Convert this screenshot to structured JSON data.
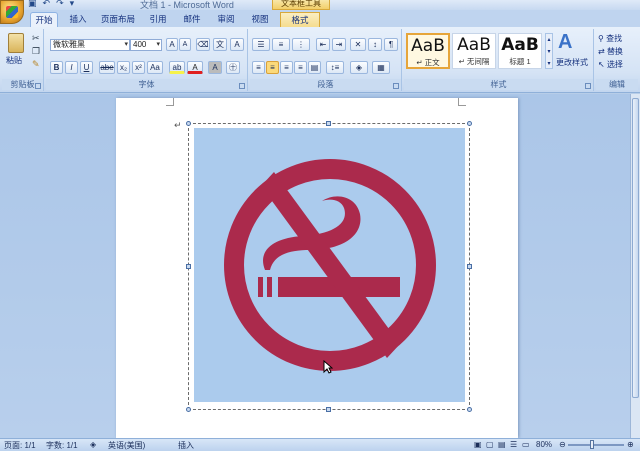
{
  "window": {
    "title": "文档 1 - Microsoft Word",
    "context_tab_header": "文本框工具",
    "qat_icons": [
      "save-icon",
      "undo-icon",
      "redo-icon"
    ]
  },
  "tabs": [
    {
      "label": "开始",
      "active": true
    },
    {
      "label": "插入"
    },
    {
      "label": "页面布局"
    },
    {
      "label": "引用"
    },
    {
      "label": "邮件"
    },
    {
      "label": "审阅"
    },
    {
      "label": "视图"
    },
    {
      "label": "格式",
      "contextual": true
    }
  ],
  "ribbon": {
    "clipboard": {
      "paste_label": "粘贴",
      "group_label": "剪贴板"
    },
    "font": {
      "font_name": "微软雅黑",
      "font_size": "400",
      "group_label": "字体",
      "buttons": [
        "B",
        "I",
        "U",
        "abe",
        "x₂",
        "x²",
        "Aa",
        "A"
      ]
    },
    "paragraph": {
      "group_label": "段落"
    },
    "styles": {
      "group_label": "样式",
      "items": [
        {
          "sample": "AaB",
          "name": "↵ 正文",
          "selected": true
        },
        {
          "sample": "AaB",
          "name": "↵ 无间隔"
        },
        {
          "sample": "AaB",
          "name": "标题 1"
        }
      ],
      "change_styles_label": "更改样式"
    },
    "editing": {
      "group_label": "编辑",
      "find_label": "查找",
      "replace_label": "替换",
      "select_label": "选择"
    }
  },
  "document": {
    "content": "no-smoking-sign",
    "sign_background_color": "#abcbed",
    "sign_color": "#ab2a4c"
  },
  "status_bar": {
    "page": "页面: 1/1",
    "words": "字数: 1/1",
    "language": "英语(美国)",
    "mode": "插入",
    "zoom": "80%"
  }
}
